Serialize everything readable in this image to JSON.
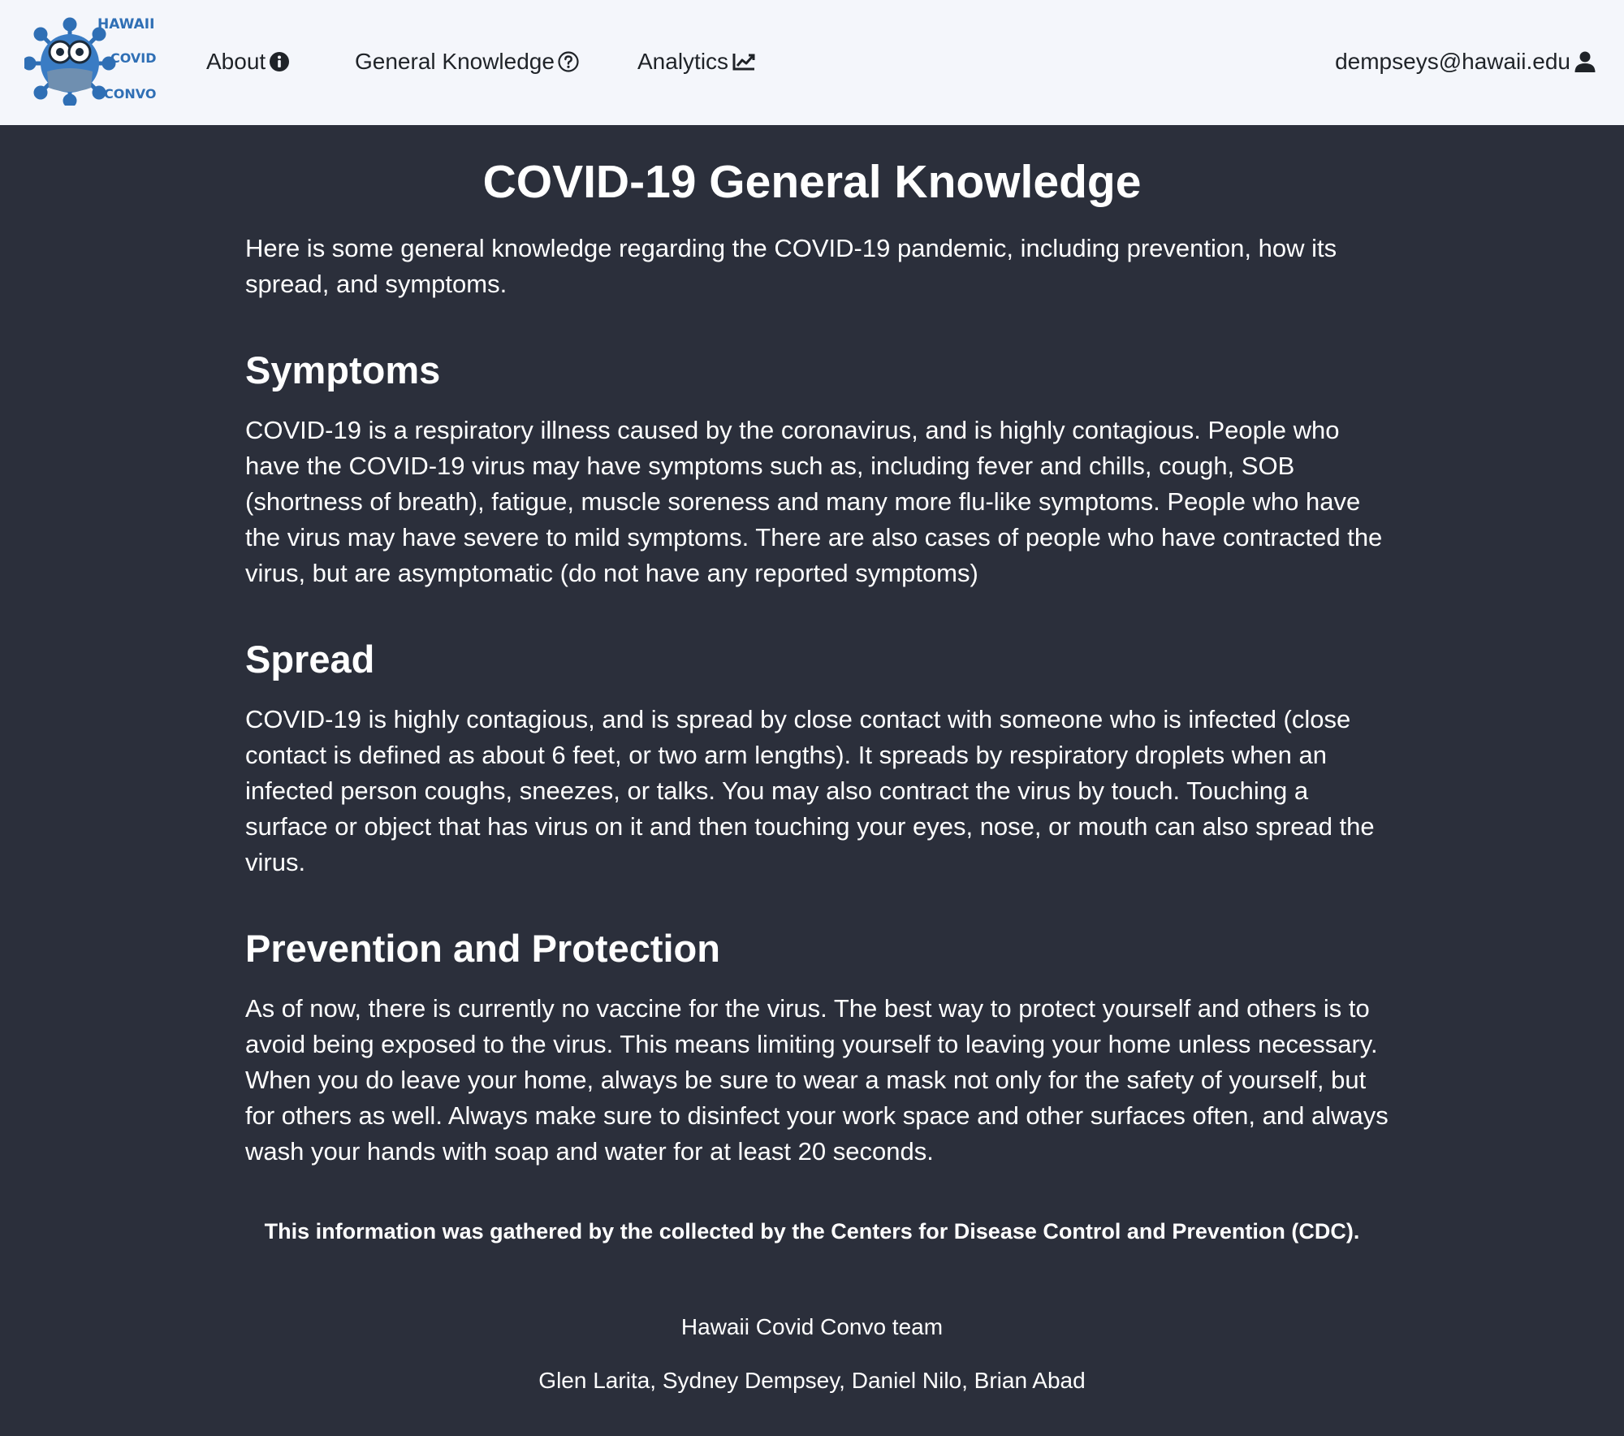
{
  "colors": {
    "navbar_bg": "#f4f6fb",
    "page_bg": "#2b2f3b",
    "text": "#ffffff",
    "logo_blue": "#2f6fb5"
  },
  "navbar": {
    "logo": {
      "line1": "HAWAII",
      "line2": "COVID",
      "line3": "CONVO",
      "icon": "virus-mascot-logo"
    },
    "items": [
      {
        "label": "About",
        "icon": "info-circle-icon"
      },
      {
        "label": "General Knowledge",
        "icon": "question-circle-icon"
      },
      {
        "label": "Analytics",
        "icon": "chart-line-icon"
      }
    ],
    "user": {
      "label": "dempseys@hawaii.edu",
      "icon": "user-icon"
    }
  },
  "main": {
    "title": "COVID-19 General Knowledge",
    "intro": "Here is some general knowledge regarding the COVID-19 pandemic, including prevention, how its spread, and symptoms.",
    "sections": [
      {
        "heading": "Symptoms",
        "body": "COVID-19 is a respiratory illness caused by the coronavirus, and is highly contagious. People who have the COVID-19 virus may have symptoms such as, including fever and chills, cough, SOB (shortness of breath), fatigue, muscle soreness and many more flu-like symptoms. People who have the virus may have severe to mild symptoms. There are also cases of people who have contracted the virus, but are asymptomatic (do not have any reported symptoms)"
      },
      {
        "heading": "Spread",
        "body": "COVID-19 is highly contagious, and is spread by close contact with someone who is infected (close contact is defined as about 6 feet, or two arm lengths). It spreads by respiratory droplets when an infected person coughs, sneezes, or talks. You may also contract the virus by touch. Touching a surface or object that has virus on it and then touching your eyes, nose, or mouth can also spread the virus."
      },
      {
        "heading": "Prevention and Protection",
        "body": "As of now, there is currently no vaccine for the virus. The best way to protect yourself and others is to avoid being exposed to the virus. This means limiting yourself to leaving your home unless necessary. When you do leave your home, always be sure to wear a mask not only for the safety of yourself, but for others as well. Always make sure to disinfect your work space and other surfaces often, and always wash your hands with soap and water for at least 20 seconds."
      }
    ],
    "source_note": "This information was gathered by the collected by the Centers for Disease Control and Prevention (CDC)."
  },
  "footer": {
    "team_title": "Hawaii Covid Convo team",
    "team_members": "Glen Larita, Sydney Dempsey, Daniel Nilo, Brian Abad"
  }
}
